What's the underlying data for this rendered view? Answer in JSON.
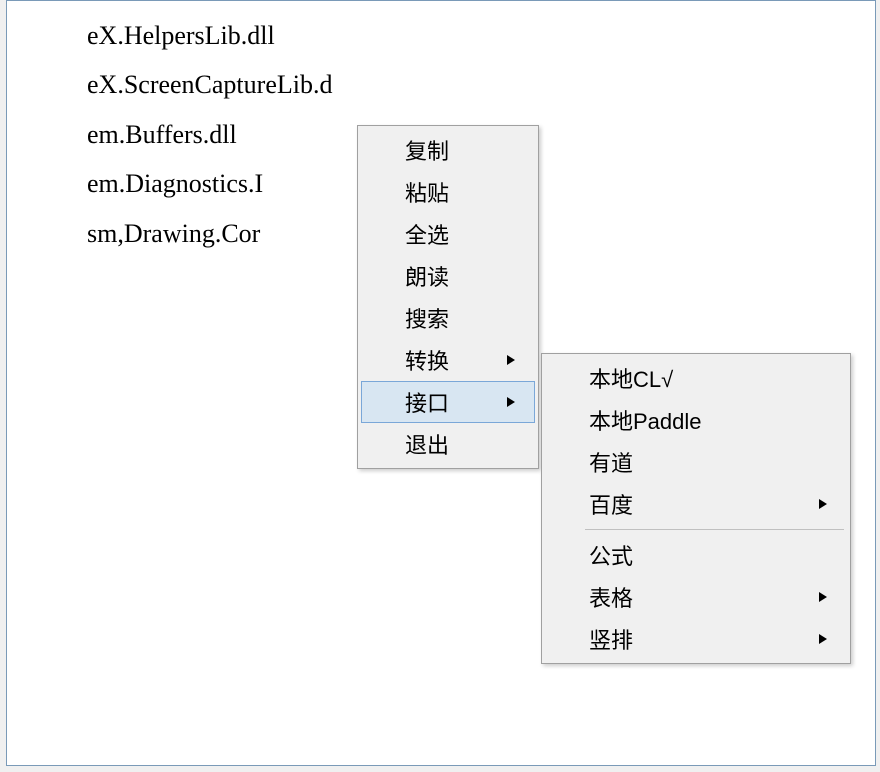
{
  "text_lines": [
    "eX.HelpersLib.dll",
    "eX.ScreenCaptureLib.d",
    "em.Buffers.dll",
    "em.Diagnostics.I",
    "sm,Drawing.Cor"
  ],
  "menu1": {
    "copy": "复制",
    "paste": "粘贴",
    "select_all": "全选",
    "read_aloud": "朗读",
    "search": "搜索",
    "convert": "转换",
    "interface": "接口",
    "exit": "退出"
  },
  "menu2": {
    "local_cl": "本地CL√",
    "local_paddle": "本地Paddle",
    "youdao": "有道",
    "baidu": "百度",
    "formula": "公式",
    "table": "表格",
    "vertical": "竖排"
  }
}
